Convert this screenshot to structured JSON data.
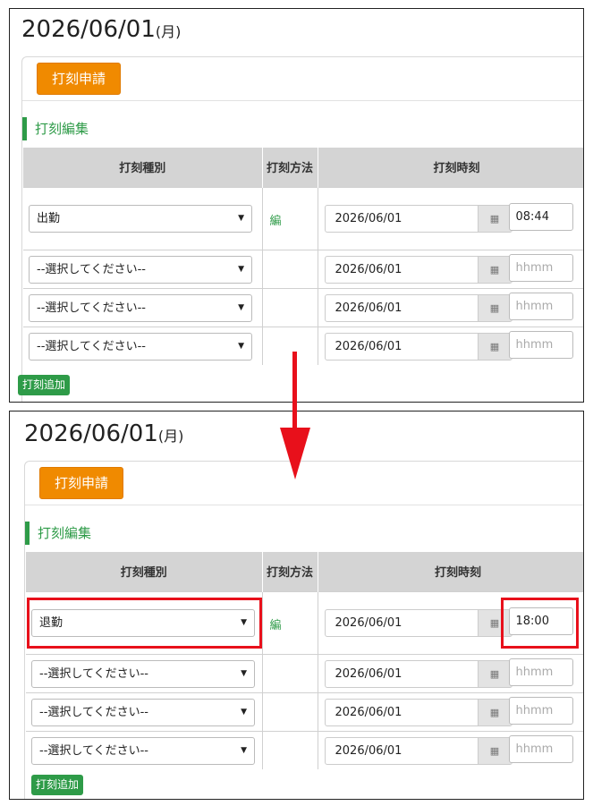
{
  "top": {
    "date": "2026/06/01",
    "day_of_week": "(月)",
    "apply_button": "打刻申請",
    "section_title": "打刻編集",
    "headers": [
      "打刻種別",
      "打刻方法",
      "打刻時刻"
    ],
    "rows": [
      {
        "type": "出勤",
        "method": "編",
        "date": "2026/06/01",
        "time": "08:44"
      },
      {
        "type": "--選択してください--",
        "method": "",
        "date": "2026/06/01",
        "time": "hhmm"
      },
      {
        "type": "--選択してください--",
        "method": "",
        "date": "2026/06/01",
        "time": "hhmm"
      },
      {
        "type": "--選択してください--",
        "method": "",
        "date": "2026/06/01",
        "time": "hhmm"
      }
    ],
    "add_button": "打刻追加"
  },
  "bottom": {
    "date": "2026/06/01",
    "day_of_week": "(月)",
    "apply_button": "打刻申請",
    "section_title": "打刻編集",
    "headers": [
      "打刻種別",
      "打刻方法",
      "打刻時刻"
    ],
    "rows": [
      {
        "type": "退勤",
        "method": "編",
        "date": "2026/06/01",
        "time": "18:00"
      },
      {
        "type": "--選択してください--",
        "method": "",
        "date": "2026/06/01",
        "time": "hhmm"
      },
      {
        "type": "--選択してください--",
        "method": "",
        "date": "2026/06/01",
        "time": "hhmm"
      },
      {
        "type": "--選択してください--",
        "method": "",
        "date": "2026/06/01",
        "time": "hhmm"
      }
    ],
    "add_button": "打刻追加"
  },
  "icons": {
    "calendar": "calendar-icon",
    "dropdown": "caret-down-icon",
    "arrow": "arrow-down-icon"
  },
  "colors": {
    "accent_orange": "#f08a00",
    "accent_green": "#2e9b48",
    "highlight_red": "#e8101b",
    "header_gray": "#d4d4d4"
  }
}
